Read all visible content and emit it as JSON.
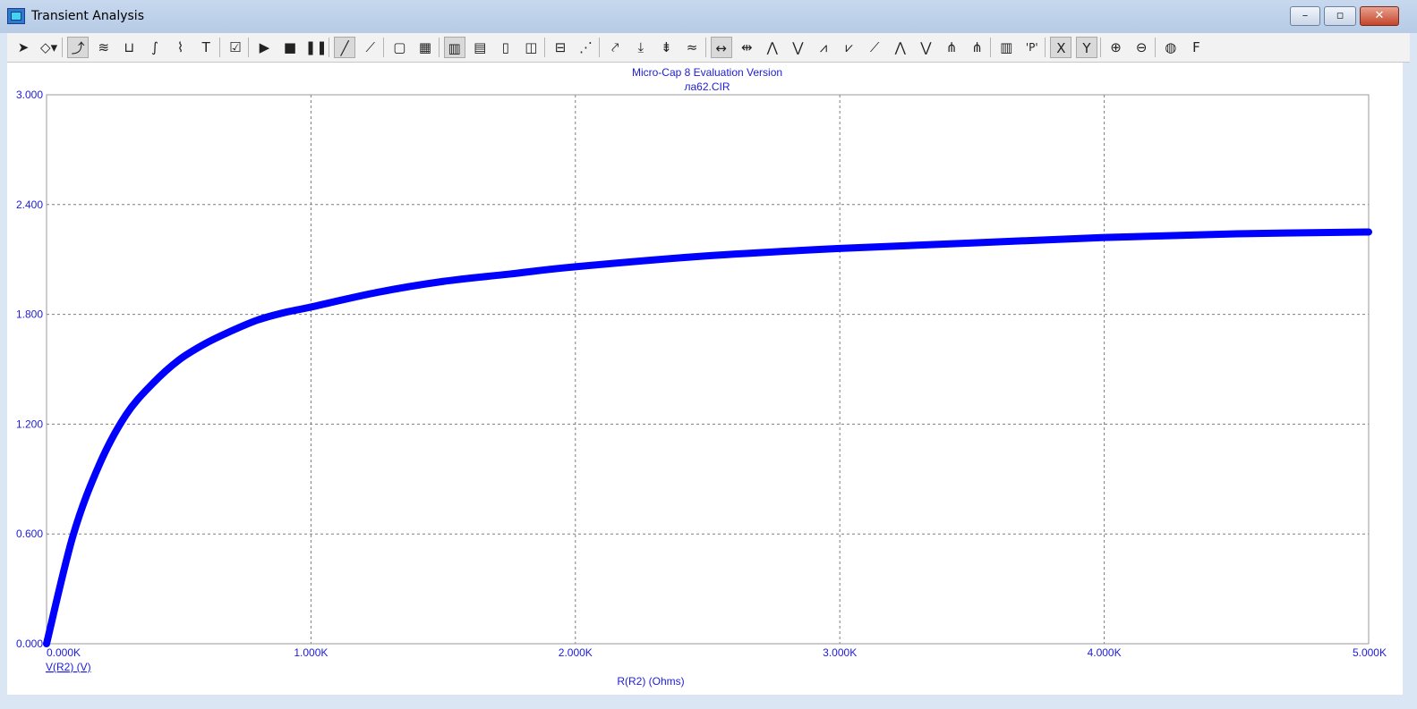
{
  "window": {
    "title": "Transient Analysis",
    "buttons": {
      "minimize": "–",
      "restore": "▫",
      "close": "✕"
    }
  },
  "toolbar": {
    "items": [
      {
        "name": "select-arrow-icon",
        "glyph": "➤",
        "interactable": true
      },
      {
        "name": "component-dropdown-icon",
        "glyph": "◇▾",
        "interactable": true
      },
      {
        "name": "scale-icon",
        "glyph": "⤴",
        "interactable": true,
        "pressed": true
      },
      {
        "name": "wave-icon",
        "glyph": "≋",
        "interactable": true
      },
      {
        "name": "bracket-icon",
        "glyph": "⊔",
        "interactable": true
      },
      {
        "name": "fit-icon",
        "glyph": "∫",
        "interactable": true
      },
      {
        "name": "step-icon",
        "glyph": "⌇",
        "interactable": true
      },
      {
        "name": "text-icon",
        "glyph": "T",
        "interactable": true
      },
      {
        "name": "properties-icon",
        "glyph": "☑",
        "interactable": true
      },
      {
        "name": "run-icon",
        "glyph": "▶",
        "interactable": true
      },
      {
        "name": "stop-icon",
        "glyph": "■",
        "interactable": true
      },
      {
        "name": "pause-icon",
        "glyph": "❚❚",
        "interactable": true
      },
      {
        "name": "line-icon",
        "glyph": "╱",
        "interactable": true,
        "pressed": true
      },
      {
        "name": "line-dots-icon",
        "glyph": "⟋",
        "interactable": true
      },
      {
        "name": "frame-icon",
        "glyph": "▢",
        "interactable": true
      },
      {
        "name": "grid-icon",
        "glyph": "▦",
        "interactable": true
      },
      {
        "name": "vgrid-icon",
        "glyph": "▥",
        "interactable": true,
        "pressed": true
      },
      {
        "name": "hgrid-icon",
        "glyph": "▤",
        "interactable": true
      },
      {
        "name": "minor-grid-icon",
        "glyph": "▯",
        "interactable": true
      },
      {
        "name": "split-icon",
        "glyph": "◫",
        "interactable": true
      },
      {
        "name": "hsplit-icon",
        "glyph": "⊟",
        "interactable": true
      },
      {
        "name": "scatter-icon",
        "glyph": "⋰",
        "interactable": true
      },
      {
        "name": "cursor-left-icon",
        "glyph": "⤤",
        "interactable": true
      },
      {
        "name": "cursor-down-icon",
        "glyph": "⤓",
        "interactable": true
      },
      {
        "name": "cursor-both-icon",
        "glyph": "⇟",
        "interactable": true
      },
      {
        "name": "cursor-wave-icon",
        "glyph": "≈",
        "interactable": true
      },
      {
        "name": "peak-left-icon",
        "glyph": "↔",
        "interactable": true,
        "pressed": true
      },
      {
        "name": "peak-right-icon",
        "glyph": "⇹",
        "interactable": true
      },
      {
        "name": "peak-icon",
        "glyph": "⋀",
        "interactable": true
      },
      {
        "name": "valley-icon",
        "glyph": "⋁",
        "interactable": true
      },
      {
        "name": "high-icon",
        "glyph": "⩘",
        "interactable": true
      },
      {
        "name": "low-icon",
        "glyph": "⩗",
        "interactable": true
      },
      {
        "name": "slope-icon",
        "glyph": "⟋",
        "interactable": true
      },
      {
        "name": "global-high-icon",
        "glyph": "⋀",
        "interactable": true
      },
      {
        "name": "global-low-icon",
        "glyph": "⋁",
        "interactable": true
      },
      {
        "name": "inflection-icon",
        "glyph": "⋔",
        "interactable": true
      },
      {
        "name": "mark-icon",
        "glyph": "⋔",
        "interactable": true
      },
      {
        "name": "table-icon",
        "glyph": "▥",
        "interactable": true
      },
      {
        "name": "point-label-icon",
        "glyph": "'P'",
        "interactable": true
      },
      {
        "name": "x-axis-icon",
        "glyph": "X",
        "interactable": true,
        "pressed": true
      },
      {
        "name": "y-axis-icon",
        "glyph": "Y",
        "interactable": true,
        "pressed": true
      },
      {
        "name": "zoom-in-icon",
        "glyph": "⊕",
        "interactable": true
      },
      {
        "name": "zoom-out-icon",
        "glyph": "⊖",
        "interactable": true
      },
      {
        "name": "color-icon",
        "glyph": "◍",
        "interactable": true
      },
      {
        "name": "font-icon",
        "glyph": "F",
        "interactable": true
      }
    ]
  },
  "plot": {
    "header_line1": "Micro-Cap 8 Evaluation Version",
    "header_line2": "ла62.CIR",
    "trace_label": "V(R2) (V)",
    "x_axis_title": "R(R2) (Ohms)",
    "accent_color": "#0000ff",
    "text_color": "#1c1cd9"
  },
  "chart_data": {
    "type": "line",
    "title": "",
    "xlabel": "R(R2) (Ohms)",
    "ylabel": "V(R2) (V)",
    "xlim": [
      0,
      5000
    ],
    "ylim": [
      0,
      3
    ],
    "x_ticks": [
      "0.000K",
      "1.000K",
      "2.000K",
      "3.000K",
      "4.000K",
      "5.000K"
    ],
    "y_ticks": [
      "0.000",
      "0.600",
      "1.200",
      "1.800",
      "2.400",
      "3.000"
    ],
    "grid": true,
    "series": [
      {
        "name": "V(R2) (V)",
        "color": "#0000ff",
        "x": [
          0,
          100,
          200,
          300,
          400,
          500,
          600,
          700,
          800,
          900,
          1000,
          1250,
          1500,
          1750,
          2000,
          2500,
          3000,
          3500,
          4000,
          4500,
          5000
        ],
        "values": [
          0,
          0.59,
          0.98,
          1.25,
          1.42,
          1.55,
          1.64,
          1.71,
          1.77,
          1.81,
          1.84,
          1.92,
          1.98,
          2.02,
          2.06,
          2.12,
          2.16,
          2.19,
          2.22,
          2.24,
          2.25
        ]
      }
    ]
  }
}
